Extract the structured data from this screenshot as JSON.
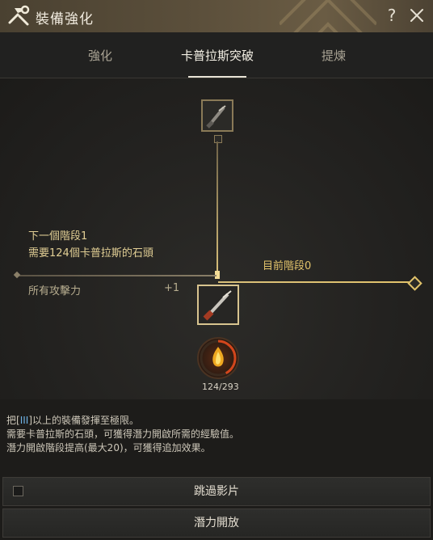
{
  "window": {
    "title": "裝備強化"
  },
  "tabs": [
    {
      "label": "強化"
    },
    {
      "label": "卡普拉斯突破"
    },
    {
      "label": "提煉"
    }
  ],
  "stage": {
    "next_stage_label": "下一個階段1",
    "requirement": "需要124個卡普拉斯的石頭",
    "current_stage_label": "目前階段0",
    "stat_name": "所有攻擊力",
    "stat_value": "+1",
    "progress_text": "124/293",
    "progress_fraction": 0.4232
  },
  "info": {
    "line1_prefix": "把[",
    "line1_roman": "III",
    "line1_suffix": "]以上的裝備發揮至極限。",
    "line2": "需要卡普拉斯的石頭，可獲得潛力開啟所需的經驗值。",
    "line3": "潛力開啟階段提高(最大20)，可獲得追加效果。"
  },
  "buttons": {
    "skip_video_label": "跳過影片",
    "unlock_potential_label": "潛力開放"
  },
  "colors": {
    "accent_gold": "#e2c36b",
    "roman_blue": "#6fb3e6"
  }
}
